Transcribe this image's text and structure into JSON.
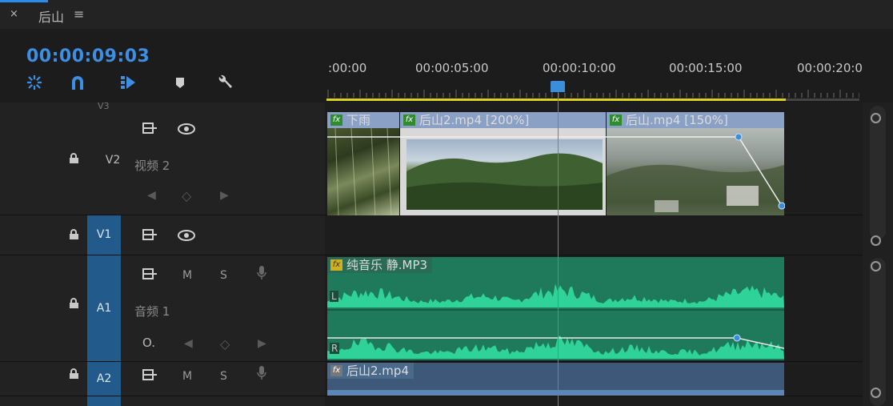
{
  "panel": {
    "close_glyph": "×",
    "sequence_name": "后山",
    "menu_glyph": "≡"
  },
  "timecode": "00:00:09:03",
  "tools": {
    "names": [
      "snap-link-icon",
      "magnet-icon",
      "add-marker-edit-icon",
      "marker-icon",
      "wrench-icon"
    ]
  },
  "ruler": {
    "labels": [
      ":00:00",
      "00:00:05:00",
      "00:00:10:00",
      "00:00:15:00",
      "00:00:20:0"
    ],
    "playhead_time": "00:00:09:03"
  },
  "tracks": {
    "v3_label": "V3",
    "v2": {
      "label": "V2",
      "name": "视频 2"
    },
    "v1": {
      "label": "V1"
    },
    "a1": {
      "label": "A1",
      "name": "音频 1",
      "mute": "M",
      "solo": "S"
    },
    "a2": {
      "label": "A2",
      "mute": "M",
      "solo": "S"
    }
  },
  "clips": {
    "v2_clip1": {
      "label": "下雨",
      "fx": "fx"
    },
    "v2_clip2": {
      "label": "后山2.mp4 [200%]",
      "fx": "fx"
    },
    "v2_clip3": {
      "label": "后山.mp4 [150%]",
      "fx": "fx"
    },
    "a1_clip": {
      "label": "纯音乐 静.MP3",
      "fx": "fx",
      "left_channel": "L",
      "right_channel": "R"
    },
    "a2_clip": {
      "label": "后山2.mp4",
      "fx": "fx"
    }
  },
  "colors": {
    "accent": "#3d8fe3",
    "audio_clip": "#1f7a5c",
    "audio_wave": "#2fd39a",
    "audio_clip_a2": "#3d5878",
    "work_area": "#d9d31e"
  }
}
